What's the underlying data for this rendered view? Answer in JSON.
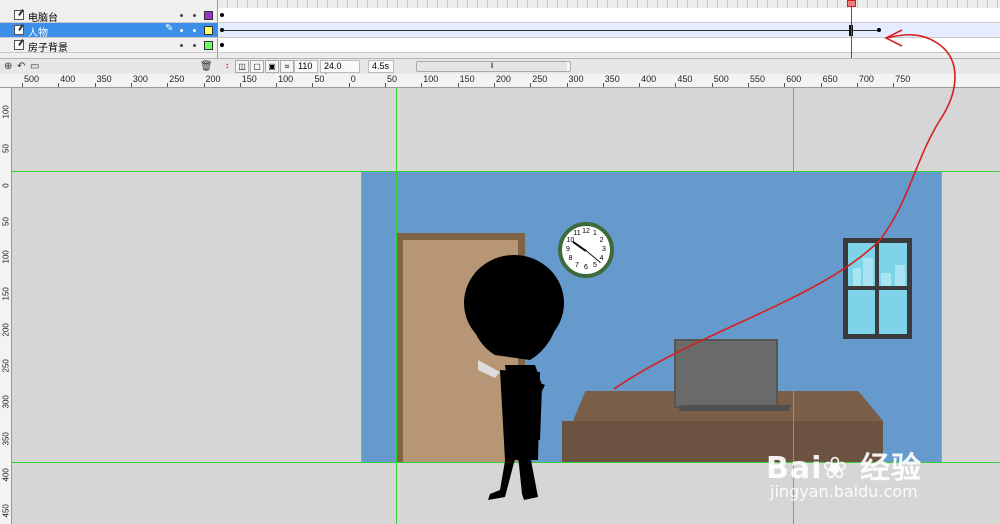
{
  "layers": [
    {
      "name": "电脑台",
      "color": "#9933cc",
      "selected": false
    },
    {
      "name": "人物",
      "color": "#ffff66",
      "selected": true
    },
    {
      "name": "房子背景",
      "color": "#66ff66",
      "selected": false
    }
  ],
  "timeline": {
    "current_frame": "110",
    "fps": "24.0 fps",
    "elapsed": "4.5s",
    "scroll_thumb": "⦀"
  },
  "ruler": {
    "h_labels": [
      "500",
      "400",
      "350",
      "300",
      "250",
      "200",
      "150",
      "100",
      "50",
      "0",
      "50",
      "100",
      "150",
      "200",
      "250",
      "300",
      "350",
      "400",
      "450",
      "500",
      "550",
      "600",
      "650",
      "700",
      "750"
    ],
    "v_labels": [
      "100",
      "50",
      "0",
      "50",
      "100",
      "150",
      "200",
      "250",
      "300",
      "350",
      "400",
      "450"
    ]
  },
  "clock_numbers": [
    "12",
    "1",
    "2",
    "3",
    "4",
    "5",
    "6",
    "7",
    "8",
    "9",
    "10",
    "11"
  ],
  "watermark": {
    "logo": "Bai❀ 经验",
    "url": "jingyan.baidu.com"
  },
  "colors": {
    "stage": "#6699cc",
    "guide": "#34d234",
    "annotation": "#d62020"
  }
}
